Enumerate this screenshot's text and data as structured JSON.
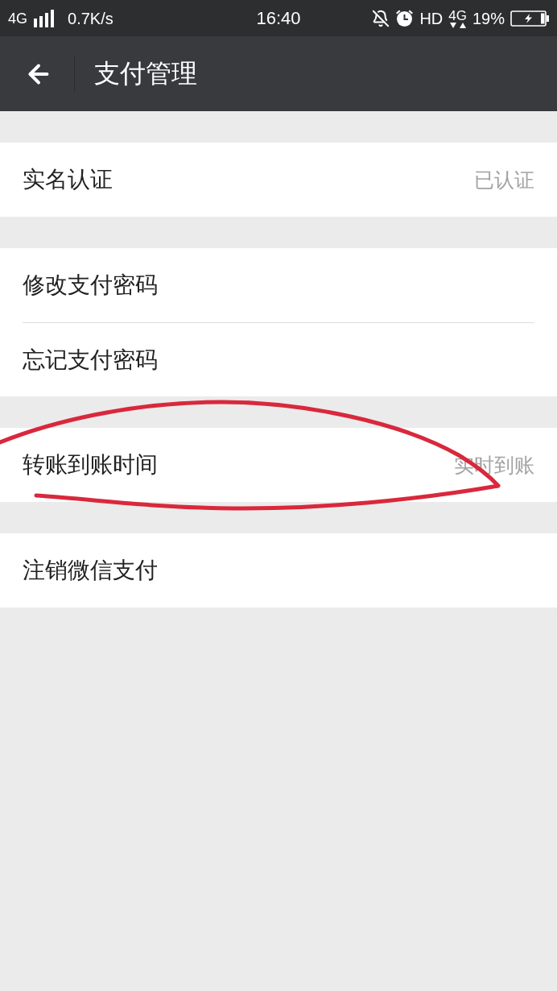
{
  "status_bar": {
    "network": "4G",
    "speed": "0.7K/s",
    "time": "16:40",
    "hd": "HD",
    "network_right": "4G",
    "battery": "19%"
  },
  "header": {
    "title": "支付管理"
  },
  "groups": [
    {
      "items": [
        {
          "label": "实名认证",
          "value": "已认证",
          "circled": false
        }
      ]
    },
    {
      "items": [
        {
          "label": "修改支付密码",
          "circled": false
        },
        {
          "label": "忘记支付密码",
          "circled": false
        }
      ]
    },
    {
      "items": [
        {
          "label": "转账到账时间",
          "value": "实时到账",
          "circled": true
        }
      ]
    },
    {
      "items": [
        {
          "label": "注销微信支付",
          "circled": false
        }
      ]
    }
  ]
}
